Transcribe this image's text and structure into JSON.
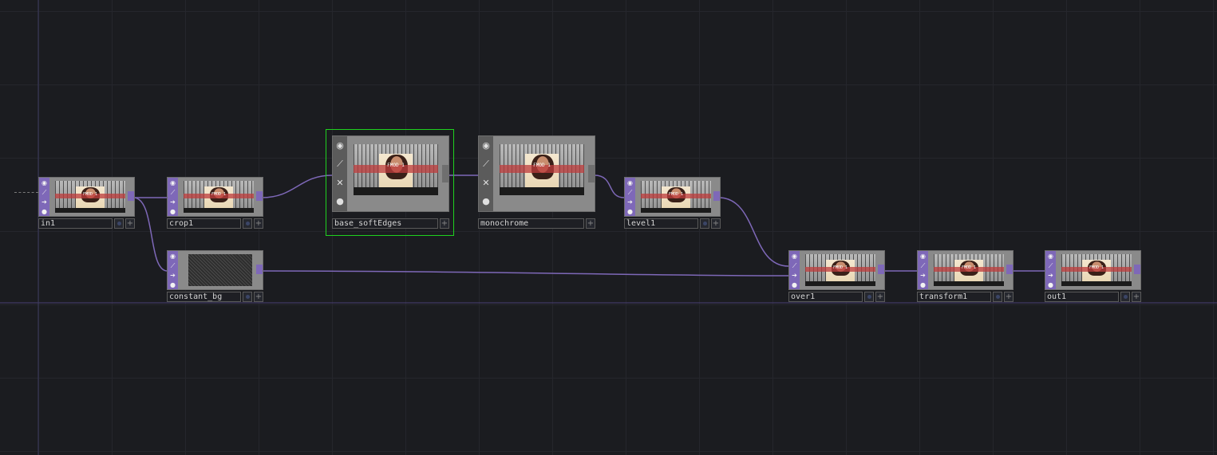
{
  "network": {
    "nodes": [
      {
        "id": "in1",
        "name": "in1",
        "kind": "image",
        "overlay_text": "FMOD 1"
      },
      {
        "id": "crop1",
        "name": "crop1",
        "kind": "image",
        "overlay_text": "FMOD 1"
      },
      {
        "id": "base_softEdges",
        "name": "base_softEdges",
        "kind": "image",
        "overlay_text": "FMOD 1",
        "selected": true
      },
      {
        "id": "monochrome",
        "name": "monochrome",
        "kind": "image",
        "overlay_text": "FMOD 1"
      },
      {
        "id": "level1",
        "name": "level1",
        "kind": "image",
        "overlay_text": "FMOD 1"
      },
      {
        "id": "constant_bg",
        "name": "constant_bg",
        "kind": "noise"
      },
      {
        "id": "over1",
        "name": "over1",
        "kind": "image",
        "overlay_text": "FMOD 1"
      },
      {
        "id": "transform1",
        "name": "transform1",
        "kind": "image",
        "overlay_text": "FMOD 1"
      },
      {
        "id": "out1",
        "name": "out1",
        "kind": "image",
        "overlay_text": "FMOD 1"
      }
    ],
    "connections": [
      {
        "from": "in1",
        "to": "crop1"
      },
      {
        "from": "in1",
        "to": "constant_bg"
      },
      {
        "from": "crop1",
        "to": "base_softEdges"
      },
      {
        "from": "base_softEdges",
        "to": "monochrome"
      },
      {
        "from": "monochrome",
        "to": "level1"
      },
      {
        "from": "level1",
        "to": "over1"
      },
      {
        "from": "constant_bg",
        "to": "over1"
      },
      {
        "from": "over1",
        "to": "transform1"
      },
      {
        "from": "transform1",
        "to": "out1"
      }
    ],
    "node_buttons": [
      "viewer-icon",
      "bypass-icon",
      "cook-icon",
      "lock-icon"
    ],
    "colors": {
      "background": "#1b1c20",
      "grid": "#25262c",
      "wire": "#7e68b8",
      "selected": "#1fd11f",
      "operator_accent": "#7e68b8"
    }
  }
}
